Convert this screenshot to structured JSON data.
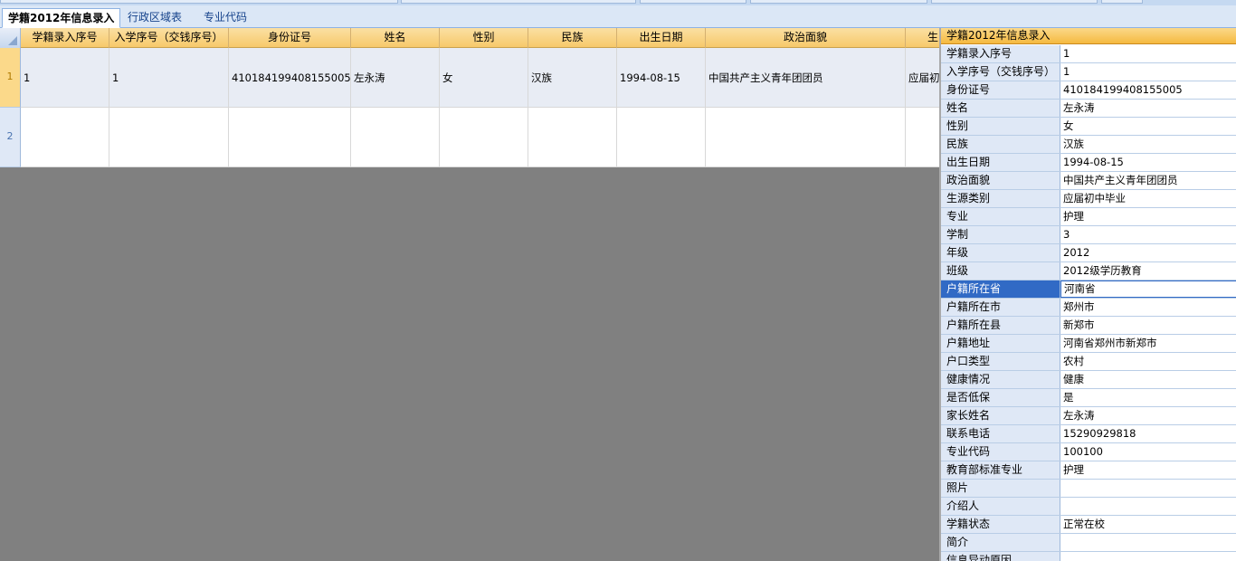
{
  "tabs": [
    {
      "label": "学籍2012年信息录入"
    },
    {
      "label": "行政区域表"
    },
    {
      "label": "专业代码"
    }
  ],
  "grid": {
    "columns": [
      "学籍录入序号",
      "入学序号（交钱序号）",
      "身份证号",
      "姓名",
      "性别",
      "民族",
      "出生日期",
      "政治面貌",
      "生"
    ],
    "row_numbers": [
      "1",
      "2"
    ],
    "rows": [
      [
        "1",
        "1",
        "410184199408155005",
        "左永涛",
        "女",
        "汉族",
        "1994-08-15",
        "中国共产主义青年团团员",
        "应届初"
      ],
      [
        "",
        "",
        "",
        "",
        "",
        "",
        "",
        "",
        ""
      ]
    ]
  },
  "panel": {
    "title": "学籍2012年信息录入",
    "selected_index": 13,
    "properties": [
      {
        "key": "学籍录入序号",
        "value": "1"
      },
      {
        "key": "入学序号（交钱序号）",
        "value": "1"
      },
      {
        "key": "身份证号",
        "value": "410184199408155005"
      },
      {
        "key": "姓名",
        "value": "左永涛"
      },
      {
        "key": "性别",
        "value": "女"
      },
      {
        "key": "民族",
        "value": "汉族"
      },
      {
        "key": "出生日期",
        "value": "1994-08-15"
      },
      {
        "key": "政治面貌",
        "value": "中国共产主义青年团团员"
      },
      {
        "key": "生源类别",
        "value": "应届初中毕业"
      },
      {
        "key": "专业",
        "value": "护理"
      },
      {
        "key": "学制",
        "value": "3"
      },
      {
        "key": "年级",
        "value": "2012"
      },
      {
        "key": "班级",
        "value": "2012级学历教育"
      },
      {
        "key": "户籍所在省",
        "value": "河南省"
      },
      {
        "key": "户籍所在市",
        "value": "郑州市"
      },
      {
        "key": "户籍所在县",
        "value": "新郑市"
      },
      {
        "key": "户籍地址",
        "value": "河南省郑州市新郑市"
      },
      {
        "key": "户口类型",
        "value": "农村"
      },
      {
        "key": "健康情况",
        "value": "健康"
      },
      {
        "key": "是否低保",
        "value": "是"
      },
      {
        "key": "家长姓名",
        "value": "左永涛"
      },
      {
        "key": "联系电话",
        "value": "15290929818"
      },
      {
        "key": "专业代码",
        "value": "100100"
      },
      {
        "key": "教育部标准专业",
        "value": "护理"
      },
      {
        "key": "照片",
        "value": ""
      },
      {
        "key": "介绍人",
        "value": ""
      },
      {
        "key": "学籍状态",
        "value": "正常在校"
      },
      {
        "key": "简介",
        "value": ""
      },
      {
        "key": "信息异动原因",
        "value": ""
      }
    ]
  },
  "colors": {
    "header": "#f7c96a",
    "panel_key_bg": "#dfe8f6",
    "selection": "#316ac5",
    "row_selected_bg": "#e8ecf4",
    "empty_area": "#808080"
  }
}
